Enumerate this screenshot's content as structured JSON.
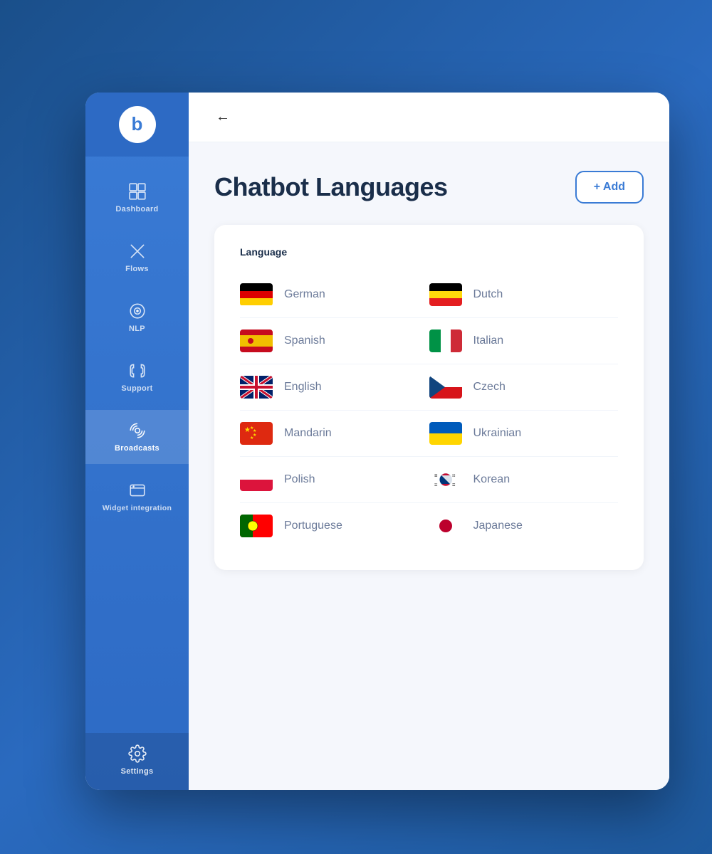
{
  "app": {
    "logo_letter": "b",
    "back_button_label": "←"
  },
  "sidebar": {
    "items": [
      {
        "id": "dashboard",
        "label": "Dashboard"
      },
      {
        "id": "flows",
        "label": "Flows"
      },
      {
        "id": "nlp",
        "label": "NLP"
      },
      {
        "id": "support",
        "label": "Support"
      },
      {
        "id": "broadcasts",
        "label": "Broadcasts"
      },
      {
        "id": "widget-integration",
        "label": "Widget integration"
      }
    ],
    "settings": {
      "label": "Settings"
    }
  },
  "header": {
    "title": "Chatbot Languages",
    "add_button": "+ Add"
  },
  "languages_section": {
    "column_header": "Language",
    "languages": [
      {
        "flag": "🇩🇪",
        "name": "German",
        "code": "de"
      },
      {
        "flag": "🇪🇸",
        "name": "Spanish",
        "code": "es"
      },
      {
        "flag": "🇬🇧",
        "name": "English",
        "code": "gb"
      },
      {
        "flag": "🇨🇳",
        "name": "Mandarin",
        "code": "cn"
      },
      {
        "flag": "🇵🇱",
        "name": "Polish",
        "code": "pl"
      },
      {
        "flag": "🇵🇹",
        "name": "Portuguese",
        "code": "pt"
      },
      {
        "flag": "🇧🇪",
        "name": "Dutch",
        "code": "be"
      },
      {
        "flag": "🇮🇹",
        "name": "Italian",
        "code": "it"
      },
      {
        "flag": "🇨🇿",
        "name": "Czech",
        "code": "cz"
      },
      {
        "flag": "🇺🇦",
        "name": "Ukrainian",
        "code": "ua"
      },
      {
        "flag": "🇰🇷",
        "name": "Korean",
        "code": "kr"
      },
      {
        "flag": "🇯🇵",
        "name": "Japanese",
        "code": "jp"
      }
    ]
  }
}
